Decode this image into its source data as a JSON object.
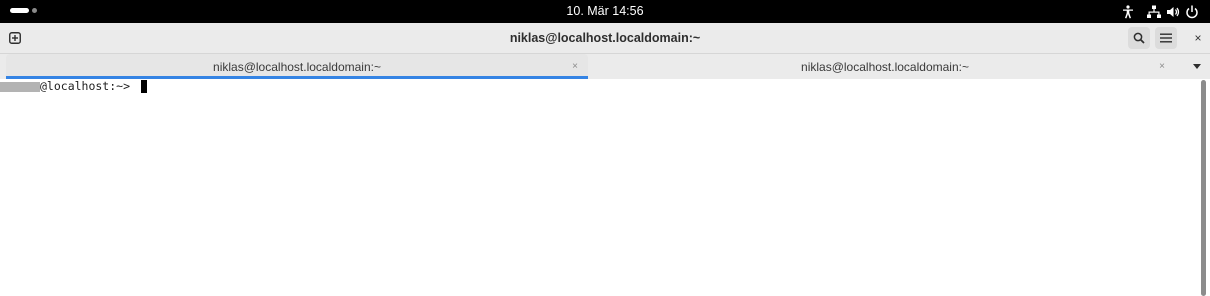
{
  "topbar": {
    "clock": "10. Mär  14:56",
    "icons": [
      "accessibility-icon",
      "network-icon",
      "volume-icon",
      "power-icon"
    ]
  },
  "window": {
    "title": "niklas@localhost.localdomain:~",
    "icons": [
      "new-tab-icon",
      "search-icon",
      "hamburger-menu-icon",
      "close-icon"
    ],
    "close_glyph": "×"
  },
  "tabs": [
    {
      "label": "niklas@localhost.localdomain:~",
      "active": true,
      "close_glyph": "×"
    },
    {
      "label": "niklas@localhost.localdomain:~",
      "active": false,
      "close_glyph": "×"
    }
  ],
  "terminal": {
    "prompt": "@localhost:~> "
  },
  "colors": {
    "topbar_bg": "#000000",
    "headerbar_bg": "#ebebeb",
    "active_tab_accent": "#3584e4",
    "terminal_bg": "#ffffff",
    "terminal_fg": "#1e1e1e"
  }
}
